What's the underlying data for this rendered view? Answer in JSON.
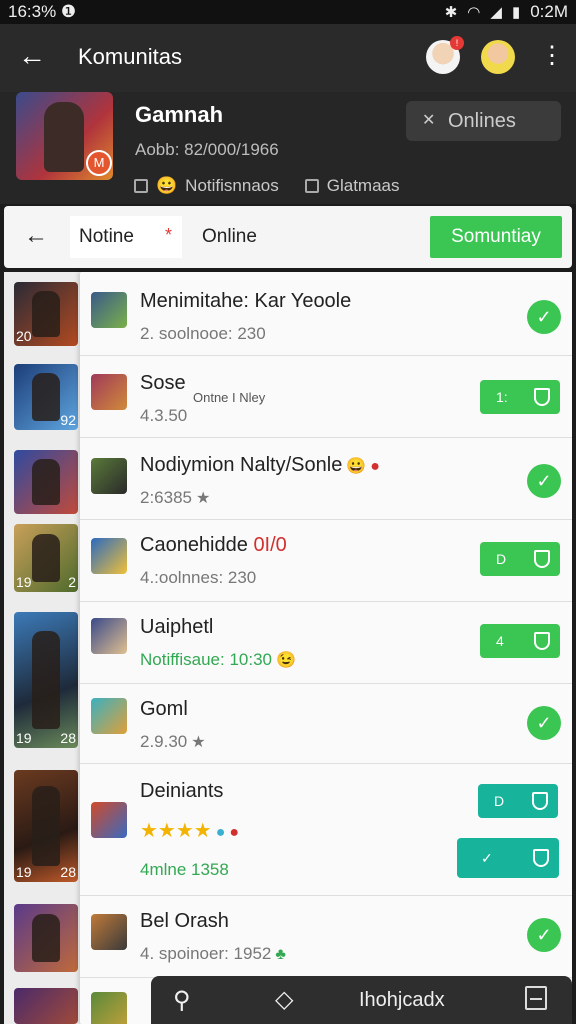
{
  "status_bar": {
    "time": "16:3% ❶",
    "battery": "0:2M"
  },
  "app_bar": {
    "title": "Komunitas",
    "badge": "!"
  },
  "header": {
    "game_name": "Gamnah",
    "sub": "Aobb: 82/000/1966",
    "online_button": "Onlines",
    "meta_a": "Notifisnnaos",
    "meta_b": "Glatmaas",
    "brand_letter": "M"
  },
  "tabs": {
    "tab_active": "Notine",
    "tab_other": "Online",
    "cta": "Somuntiay"
  },
  "thumb_numbers": [
    {
      "a": "20",
      "b": ""
    },
    {
      "a": "",
      "b": "92"
    },
    {
      "a": "",
      "b": ""
    },
    {
      "a": "19",
      "b": "2"
    },
    {
      "a": "19",
      "b": "28"
    },
    {
      "a": "19",
      "b": "28"
    },
    {
      "a": "",
      "b": ""
    },
    {
      "a": "",
      "b": ""
    }
  ],
  "rows": [
    {
      "name": "Menimitahe: Kar Yeoole",
      "sub": "2. soolnooe: 230",
      "action": "check"
    },
    {
      "name": "Sose",
      "mid": "Ontne I Nley",
      "sub": "4.3.50",
      "action": "pill",
      "pill_label": "1:"
    },
    {
      "name": "Nodiymion Nalty/Sonle",
      "sub": "2:6385",
      "action": "check"
    },
    {
      "name": "Caonehidde",
      "name_tag": "0I/0",
      "sub": "4.:oolnnes: 230",
      "action": "pill",
      "pill_label": "D"
    },
    {
      "name": "Uaiphetl",
      "sub": "Notiffisaue: 10:30",
      "action": "pill",
      "pill_label": "4"
    },
    {
      "name": "Goml",
      "sub": "2.9.30",
      "action": "check"
    },
    {
      "name": "Deiniants",
      "stars": "★★★★",
      "sub": "4mlne 1358",
      "action": "pills",
      "pill_label": "D",
      "pill_label_2": "✓"
    },
    {
      "name": "Bel Orash",
      "sub": "4. spoinoer: 1952",
      "action": "check"
    }
  ],
  "bottom_bar": {
    "label": "Ihohjcadx"
  }
}
